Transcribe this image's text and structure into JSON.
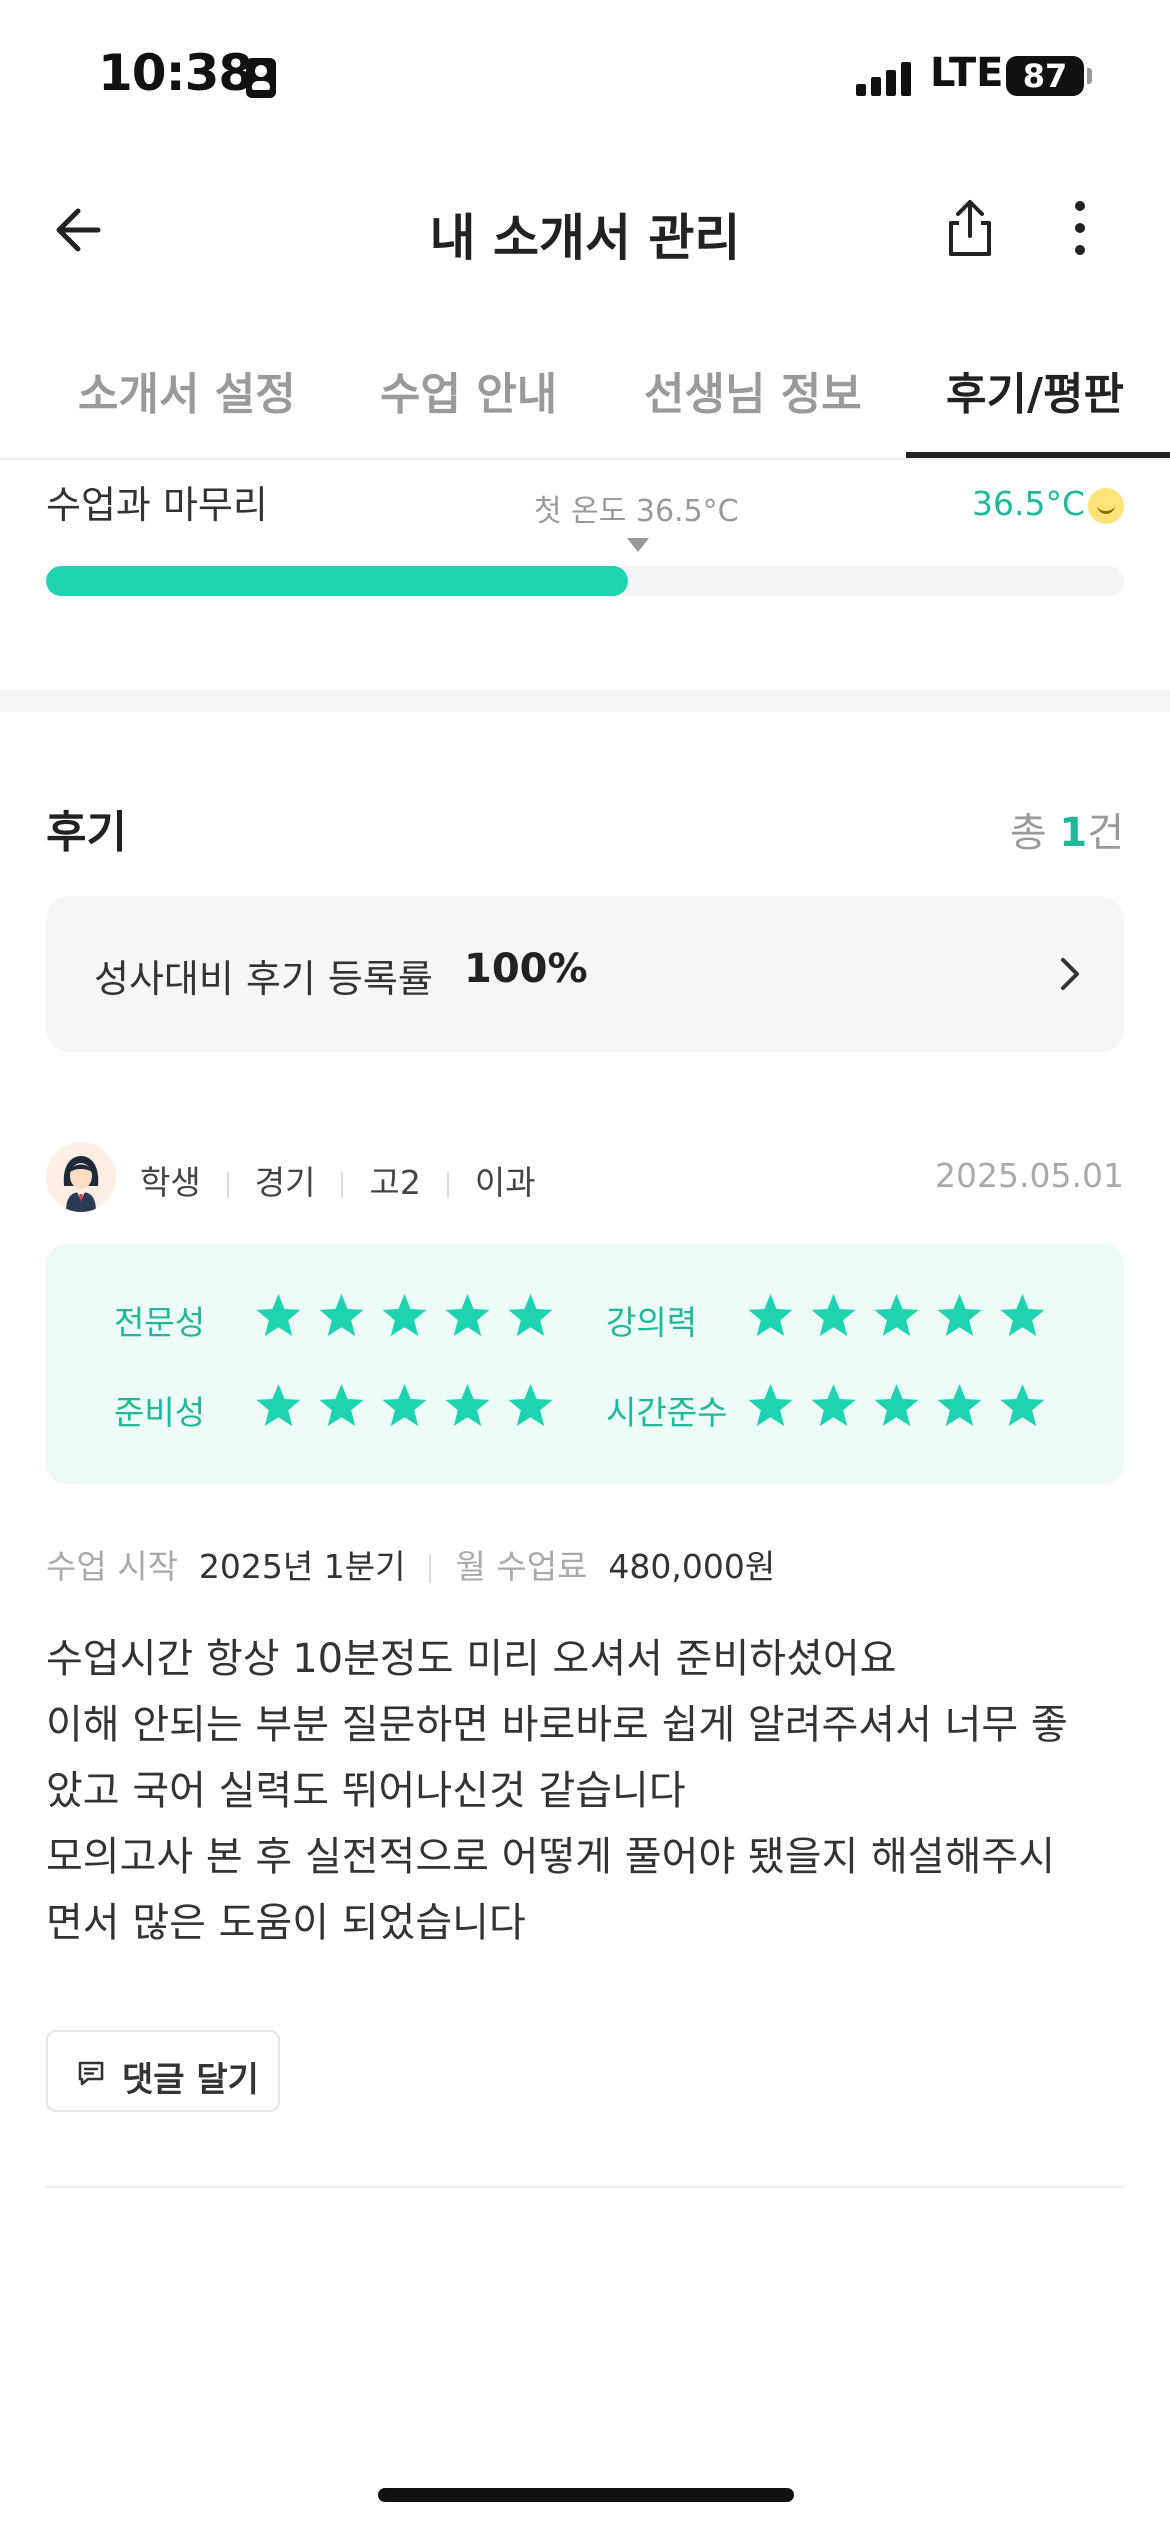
{
  "status_bar": {
    "time": "10:38",
    "network": "LTE",
    "battery": "87"
  },
  "header": {
    "title": "내 소개서 관리"
  },
  "tabs": [
    {
      "label": "소개서 설정",
      "active": false
    },
    {
      "label": "수업 안내",
      "active": false
    },
    {
      "label": "선생님 정보",
      "active": false
    },
    {
      "label": "후기/평판",
      "active": true
    }
  ],
  "temperature": {
    "label": "수업과 마무리",
    "first_temp": "첫 온도 36.5°C",
    "value": "36.5°C",
    "progress": 0.54,
    "accent": "#1ed3b0"
  },
  "reviews": {
    "title": "후기",
    "count_prefix": "총 ",
    "count": "1",
    "count_suffix": "건",
    "rate_label": "성사대비 후기 등록률",
    "rate_value": "100%",
    "items": [
      {
        "role": "학생",
        "region": "경기",
        "grade": "고2",
        "track": "이과",
        "date": "2025.05.01",
        "scores": [
          {
            "label": "전문성",
            "stars": 5
          },
          {
            "label": "강의력",
            "stars": 5
          },
          {
            "label": "준비성",
            "stars": 5
          },
          {
            "label": "시간준수",
            "stars": 5
          }
        ],
        "start_key": "수업 시작",
        "start_value": "2025년 1분기",
        "fee_key": "월 수업료",
        "fee_value": "480,000원",
        "body_lines": [
          "수업시간 항상 10분정도 미리 오셔서 준비하셨어요",
          "이해 안되는 부분 질문하면 바로바로 쉽게 알려주셔서 너무 좋",
          "았고 국어 실력도 뛰어나신것 같습니다",
          "모의고사 본 후 실전적으로 어떻게 풀어야 됐을지 해설해주시",
          "면서 많은 도움이 되었습니다"
        ],
        "comment_label": "댓글 달기"
      }
    ]
  },
  "colors": {
    "accent": "#1ed3b0",
    "accent_text": "#1fb89a",
    "score_bg": "#ecfbf7"
  }
}
